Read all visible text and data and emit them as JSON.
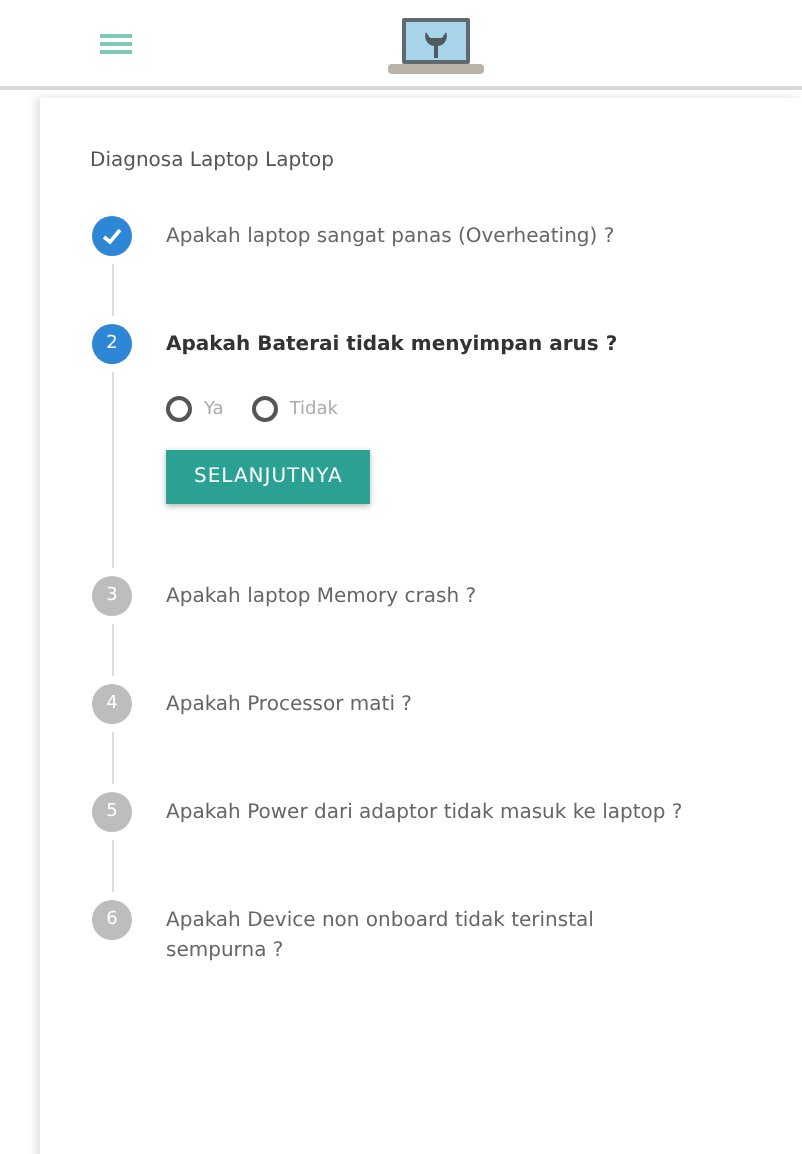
{
  "title": "Diagnosa Laptop Laptop",
  "steps": [
    {
      "label": "Apakah laptop sangat panas (Overheating) ?",
      "done": true,
      "active": false
    },
    {
      "number": "2",
      "label": "Apakah Baterai tidak menyimpan arus ?",
      "done": false,
      "active": true,
      "options": [
        {
          "label": "Ya",
          "selected": false
        },
        {
          "label": "Tidak",
          "selected": false
        }
      ],
      "button": "SELANJUTNYA"
    },
    {
      "number": "3",
      "label": "Apakah laptop Memory crash ?",
      "done": false,
      "active": false
    },
    {
      "number": "4",
      "label": "Apakah Processor mati ?",
      "done": false,
      "active": false
    },
    {
      "number": "5",
      "label": "Apakah Power dari adaptor tidak masuk ke laptop ?",
      "done": false,
      "active": false
    },
    {
      "number": "6",
      "label": "Apakah Device non onboard tidak terinstal sempurna ?",
      "done": false,
      "active": false
    }
  ]
}
